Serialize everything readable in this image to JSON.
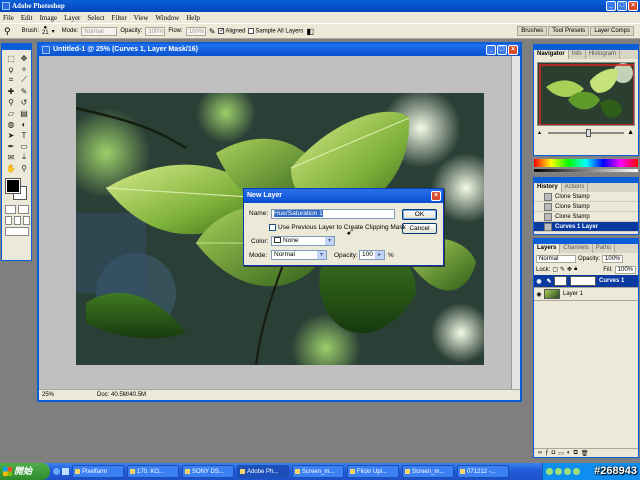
{
  "app": {
    "title": "Adobe Photoshop"
  },
  "menu": [
    "File",
    "Edit",
    "Image",
    "Layer",
    "Select",
    "Filter",
    "View",
    "Window",
    "Help"
  ],
  "options_bar": {
    "brush_label": "Brush:",
    "brush_size": "21",
    "mode_label": "Mode:",
    "mode_value": "Normal",
    "opacity_label": "Opacity:",
    "opacity_value": "100%",
    "flow_label": "Flow:",
    "flow_value": "100%",
    "aligned_label": "Aligned",
    "sample_all_label": "Sample All Layers",
    "well_tabs": [
      "Brushes",
      "Tool Presets",
      "Layer Comps"
    ]
  },
  "document": {
    "title": "Untitled-1 @ 25% (Curves 1, Layer Mask/16)",
    "zoom": "25%",
    "doc_size": "Doc: 40.5M/40.5M"
  },
  "navigator": {
    "tabs": [
      "Navigator",
      "Info",
      "Histogram"
    ]
  },
  "history": {
    "tabs": [
      "History",
      "Actions"
    ],
    "items": [
      "Clone Stamp",
      "Clone Stamp",
      "Clone Stamp",
      "Curves 1 Layer"
    ]
  },
  "layers": {
    "tabs": [
      "Layers",
      "Channels",
      "Paths"
    ],
    "blend_mode": "Normal",
    "opacity_label": "Opacity:",
    "opacity_value": "100%",
    "lock_label": "Lock:",
    "fill_label": "Fill:",
    "fill_value": "100%",
    "items": [
      "Curves 1",
      "Layer 1"
    ]
  },
  "dialog": {
    "title": "New Layer",
    "name_label": "Name:",
    "name_value": "Hue/Saturation 1",
    "clip_label": "Use Previous Layer to Create Clipping Mask",
    "color_label": "Color:",
    "color_value": "None",
    "mode_label": "Mode:",
    "mode_value": "Normal",
    "opacity_label": "Opacity:",
    "opacity_value": "100",
    "opacity_unit": "%",
    "ok_label": "OK",
    "cancel_label": "Cancel"
  },
  "taskbar": {
    "start": "開始",
    "tasks": [
      "Pixelfarm",
      "170. KO...",
      "SONY DS...",
      "Adobe Ph...",
      "Screen_m...",
      "Flickr Upl...",
      "Screen_m...",
      "071212 -..."
    ],
    "active_task_index": 3
  },
  "watermark": "#268943",
  "colors": {
    "accent": "#0a5fd8",
    "taskbar": "#245edb",
    "selection": "#0a3aa0"
  }
}
